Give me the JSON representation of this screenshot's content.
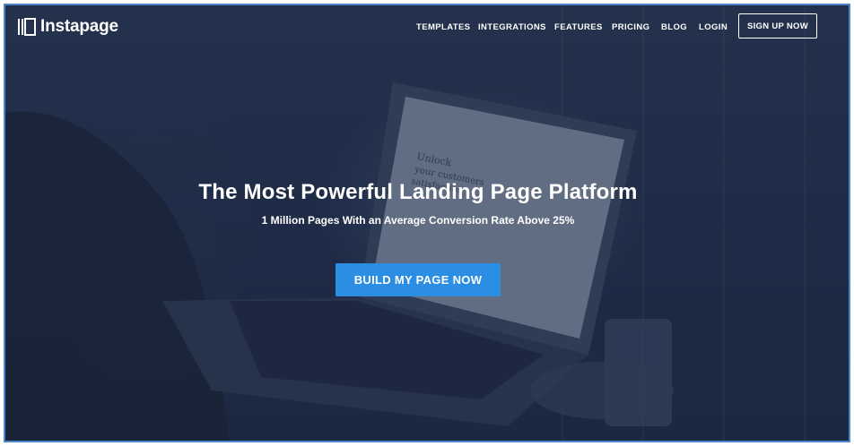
{
  "brand": {
    "name": "Instapage",
    "logo_icon": "instapage-logo-icon"
  },
  "nav": {
    "items": [
      {
        "label": "TEMPLATES"
      },
      {
        "label": "INTEGRATIONS"
      },
      {
        "label": "FEATURES"
      },
      {
        "label": "PRICING"
      },
      {
        "label": "BLOG"
      },
      {
        "label": "LOGIN"
      }
    ],
    "signup_label": "SIGN UP NOW"
  },
  "hero": {
    "title": "The Most Powerful Landing Page Platform",
    "subtitle": "1 Million Pages With an Average Conversion Rate Above 25%",
    "cta_label": "BUILD MY PAGE NOW",
    "laptop_screen_text": "Unlock your customers satisfaction"
  },
  "colors": {
    "accent": "#2b8ee3",
    "frame_border": "#4a86c8",
    "overlay": "#1c2940"
  }
}
